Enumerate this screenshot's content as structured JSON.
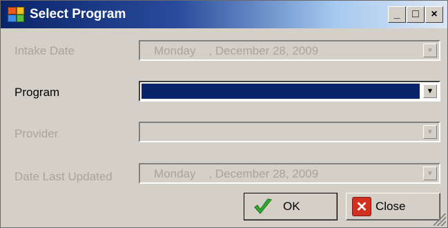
{
  "window": {
    "title": "Select Program",
    "icon": "app-icon",
    "minimize_label": "_",
    "maximize_label": "□",
    "close_label": "×"
  },
  "form": {
    "intake_date": {
      "label": "Intake Date",
      "day": "Monday",
      "date": ", December 28, 2009",
      "enabled": false
    },
    "program": {
      "label": "Program",
      "value": "",
      "enabled": true
    },
    "provider": {
      "label": "Provider",
      "value": "",
      "enabled": false
    },
    "date_last_updated": {
      "label": "Date Last Updated",
      "day": "Monday",
      "date": ", December 28, 2009",
      "enabled": false
    }
  },
  "buttons": {
    "ok_label": "OK",
    "close_label": "Close"
  },
  "colors": {
    "selection": "#0a246a",
    "disabled_text": "#a8a49c",
    "window_bg": "#d4d0c8"
  }
}
